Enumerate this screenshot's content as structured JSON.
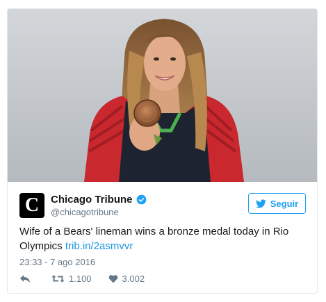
{
  "tweet": {
    "author": {
      "display_name": "Chicago Tribune",
      "handle": "@chicagotribune",
      "logo_letter": "C",
      "verified": true
    },
    "follow_label": "Seguir",
    "text": "Wife of a Bears' lineman wins a bronze medal today in Rio Olympics",
    "link": "trib.in/2asmvvr",
    "timestamp": "23:33 - 7 ago 2016",
    "retweets": "1.100",
    "likes": "3.002"
  },
  "icons": {
    "reply": "reply-icon",
    "retweet": "retweet-icon",
    "like": "heart-icon",
    "verified": "verified-badge-icon",
    "follow": "twitter-bird-icon"
  },
  "colors": {
    "accent": "#1da1f2",
    "link": "#1b95e0",
    "muted": "#657786",
    "border": "#e1e8ed"
  }
}
